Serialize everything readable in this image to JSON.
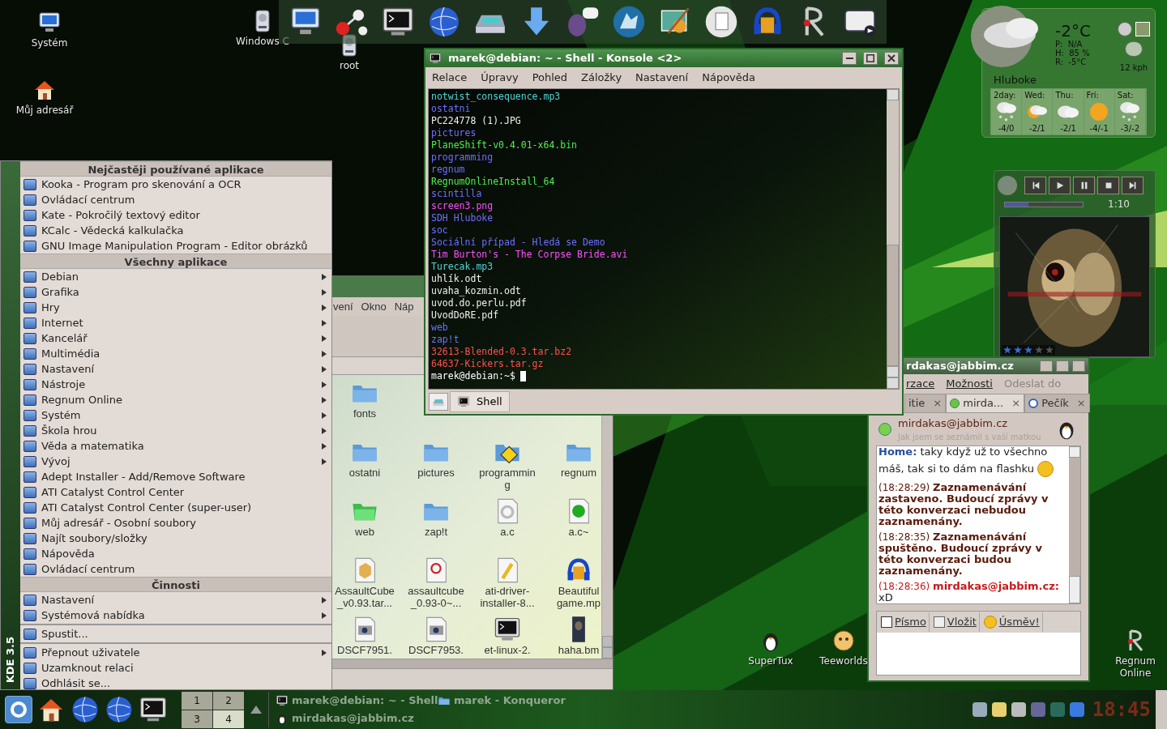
{
  "desktop_icons": [
    {
      "label": "Systém",
      "kind": "computer"
    },
    {
      "label": "Můj adresář",
      "kind": "home"
    },
    {
      "label": "Windows C",
      "kind": "drive"
    },
    {
      "label": "root",
      "kind": "drive"
    },
    {
      "label": "SuperTux",
      "kind": "penguin"
    },
    {
      "label": "Teeworlds",
      "kind": "game"
    },
    {
      "label": "Regnum Online",
      "kind": "wand"
    }
  ],
  "konsole": {
    "title": "marek@debian: ~ - Shell - Konsole <2>",
    "menu": [
      "Relace",
      "Úpravy",
      "Pohled",
      "Záložky",
      "Nastavení",
      "Nápověda"
    ],
    "lines": [
      {
        "text": "notwist_consequence.mp3",
        "kind": "audio"
      },
      {
        "text": "ostatni",
        "kind": "dir"
      },
      {
        "text": "PC224778 (1).JPG",
        "kind": "file"
      },
      {
        "text": "pictures",
        "kind": "dir"
      },
      {
        "text": "PlaneShift-v0.4.01-x64.bin",
        "kind": "exec"
      },
      {
        "text": "programming",
        "kind": "dir"
      },
      {
        "text": "regnum",
        "kind": "dir"
      },
      {
        "text": "RegnumOnlineInstall_64",
        "kind": "exec"
      },
      {
        "text": "scintilla",
        "kind": "dir"
      },
      {
        "text": "screen3.png"
      },
      {
        "text": "SDH Hluboke",
        "kind": "dir"
      },
      {
        "text": "soc",
        "kind": "dir"
      },
      {
        "text": "Sociální případ - Hledá se Demo",
        "kind": "dir"
      },
      {
        "text": "Tim Burton's - The Corpse Bride.avi"
      },
      {
        "text": "Turecak.mp3",
        "kind": "audio"
      },
      {
        "text": "uhlík.odt",
        "kind": "file"
      },
      {
        "text": "uvaha_kozmin.odt",
        "kind": "file"
      },
      {
        "text": "uvod.do.perlu.pdf",
        "kind": "file"
      },
      {
        "text": "UvodDoRE.pdf",
        "kind": "file"
      },
      {
        "text": "web",
        "kind": "dir"
      },
      {
        "text": "zap!t",
        "kind": "dir"
      },
      {
        "text": "32613-Blended-0.3.tar.bz2",
        "kind": "archive"
      },
      {
        "text": "64637-Kickers.tar.gz",
        "kind": "archive"
      }
    ],
    "prompt": "marek@debian:~$",
    "tabs": [
      {
        "label": "Shell",
        "selected": true
      }
    ]
  },
  "konqueror": {
    "menu": [
      "vení",
      "Okno",
      "Náp"
    ],
    "items": [
      {
        "label": "fonts",
        "kind": "folder"
      },
      {
        "label": "ostatni",
        "kind": "folder"
      },
      {
        "label": "pictures",
        "kind": "folder"
      },
      {
        "label": "programming",
        "kind": "folder-warning"
      },
      {
        "label": "regnum",
        "kind": "folder"
      },
      {
        "label": "web",
        "kind": "folder-green"
      },
      {
        "label": "zap!t",
        "kind": "folder"
      },
      {
        "label": "a.c",
        "kind": "source"
      },
      {
        "label": "a.c~",
        "kind": "backup"
      },
      {
        "label": "AssaultCube _v0.93.tar...",
        "kind": "package"
      },
      {
        "label": "assaultcube _0.93-0~...",
        "kind": "debian"
      },
      {
        "label": "ati-driver-installer-8...",
        "kind": "script"
      },
      {
        "label": "Beautiful game.mp",
        "kind": "audio"
      },
      {
        "label": "DSCF7951.",
        "kind": "camera"
      },
      {
        "label": "DSCF7953.",
        "kind": "camera"
      },
      {
        "label": "et-linux-2.",
        "kind": "terminal"
      },
      {
        "label": "haha.bm",
        "kind": "thumbnail"
      }
    ]
  },
  "k_menu": {
    "side_label": "KDE 3.5",
    "sections": [
      {
        "title": "Nejčastěji používané aplikace",
        "items": [
          {
            "label": "Kooka - Program pro skenování a OCR",
            "submenu": false
          },
          {
            "label": "Ovládací centrum",
            "submenu": false
          },
          {
            "label": "Kate - Pokročilý textový editor",
            "submenu": false
          },
          {
            "label": "KCalc - Vědecká kalkulačka",
            "submenu": false
          },
          {
            "label": "GNU Image Manipulation Program - Editor obrázků",
            "submenu": false
          }
        ]
      },
      {
        "title": "Všechny aplikace",
        "items": [
          {
            "label": "Debian",
            "submenu": true
          },
          {
            "label": "Grafika",
            "submenu": true
          },
          {
            "label": "Hry",
            "submenu": true
          },
          {
            "label": "Internet",
            "submenu": true
          },
          {
            "label": "Kancelář",
            "submenu": true
          },
          {
            "label": "Multimédia",
            "submenu": true
          },
          {
            "label": "Nastavení",
            "submenu": true
          },
          {
            "label": "Nástroje",
            "submenu": true
          },
          {
            "label": "Regnum Online",
            "submenu": true
          },
          {
            "label": "Systém",
            "submenu": true
          },
          {
            "label": "Škola hrou",
            "submenu": true
          },
          {
            "label": "Věda a matematika",
            "submenu": true
          },
          {
            "label": "Vývoj",
            "submenu": true
          },
          {
            "label": "Adept Installer - Add/Remove Software",
            "submenu": false
          },
          {
            "label": "ATI Catalyst Control Center",
            "submenu": false
          },
          {
            "label": "ATI Catalyst Control Center (super-user)",
            "submenu": false
          },
          {
            "label": "Můj adresář - Osobní soubory",
            "submenu": false
          },
          {
            "label": "Najít soubory/složky",
            "submenu": false
          },
          {
            "label": "Nápověda",
            "submenu": false
          },
          {
            "label": "Ovládací centrum",
            "submenu": false
          }
        ]
      },
      {
        "title": "Činnosti",
        "items": [
          {
            "label": "Nastavení",
            "submenu": true
          },
          {
            "label": "Systémová nabídka",
            "submenu": true
          },
          {
            "label": "Spustit...",
            "submenu": false,
            "separator_before": true
          },
          {
            "label": "Přepnout uživatele",
            "submenu": true,
            "separator_before": true
          },
          {
            "label": "Uzamknout relaci",
            "submenu": false
          },
          {
            "label": "Odhlásit se...",
            "submenu": false
          }
        ]
      }
    ]
  },
  "kopete": {
    "title": "rdakas@jabbim.cz",
    "menu": [
      {
        "label": "rzace",
        "disabled": false
      },
      {
        "label": "Možnosti",
        "disabled": false
      },
      {
        "label": "Odeslat do",
        "disabled": true
      }
    ],
    "tabs": [
      {
        "label": "itie",
        "selected": false,
        "kind": "none",
        "close": "×"
      },
      {
        "label": "mirda...",
        "selected": true,
        "kind": "online",
        "close": "×"
      },
      {
        "label": "Pečík",
        "selected": false,
        "kind": "away",
        "close": "×"
      }
    ],
    "contact": {
      "name": "mirdakas@jabbim.cz",
      "status_message": "Jak jsem se seznámil s vaší matkou"
    },
    "messages": [
      {
        "kind": "incoming",
        "text": "**Home:** taky když už to všechno"
      },
      {
        "kind": "incoming",
        "text": "máš, tak si to dám na flashku"
      },
      {
        "kind": "system",
        "time": "(18:28:29)",
        "text": "Zaznamenávání zastaveno. Budoucí zprávy v této konverzaci nebudou zaznamenány."
      },
      {
        "kind": "system",
        "time": "(18:28:35)",
        "text": "Zaznamenávání spuštěno. Budoucí zprávy v této konverzaci budou zaznamenány."
      },
      {
        "kind": "own",
        "time": "(18:28:36)",
        "sender": "mirdakas@jabbim.cz:",
        "text": "xD"
      }
    ],
    "toolbar": [
      "Písmo",
      "Vložit",
      "Úsměv!"
    ]
  },
  "weather": {
    "temperature": "-2°C",
    "pressure": "P:  N/A",
    "humidity": "H:  85 %",
    "real_feel": "R:  -5°C",
    "wind": "12 kph",
    "location": "Hluboke",
    "forecast": [
      {
        "day": "2day:",
        "temp": "-4/0",
        "kind": "snow"
      },
      {
        "day": "Wed:",
        "temp": "-2/1",
        "kind": "sun-cloud"
      },
      {
        "day": "Thu:",
        "temp": "-2/1",
        "kind": "cloud"
      },
      {
        "day": "Fri:",
        "temp": "-4/-1",
        "kind": "sun"
      },
      {
        "day": "Sat:",
        "temp": "-3/-2",
        "kind": "snow"
      }
    ]
  },
  "player": {
    "level": 0.3,
    "time": "1:10",
    "stars": 3
  },
  "taskbar": {
    "desks": [
      {
        "label": "1",
        "selected": false
      },
      {
        "label": "2",
        "selected": false
      },
      {
        "label": "3",
        "selected": false
      },
      {
        "label": "4",
        "selected": true
      }
    ],
    "tasks": [
      {
        "label": "marek@debian: ~ - Shell",
        "kind": "terminal"
      },
      {
        "label": "marek - Konqueror",
        "kind": "folder"
      },
      {
        "label": "mirdakas@jabbim.cz",
        "kind": "penguin"
      }
    ],
    "clock": "18:45"
  }
}
